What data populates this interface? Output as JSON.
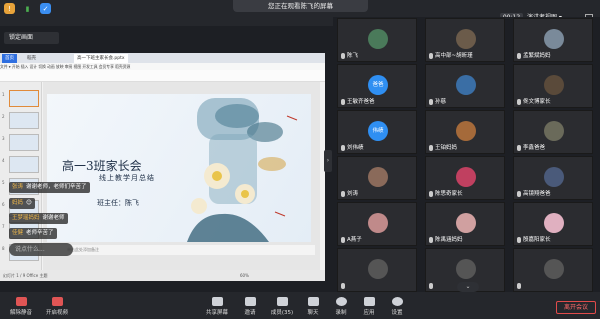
{
  "top": {
    "share_banner": "您正在观看陈飞的屏幕",
    "timer": "00:12",
    "view_mode": "演讲者视图 ▾"
  },
  "screen": {
    "lock_label": "锁定画面",
    "ppt": {
      "tabs": [
        "首页",
        "稻壳",
        "高一下班主家长会.pptx"
      ],
      "menu": "文件 ▾  开始  插入  设计  切换  动画  放映  审阅  视图  开发工具  会员专享  稻壳资源",
      "thumb_numbers": [
        "1",
        "2",
        "3",
        "4",
        "5",
        "6",
        "7",
        "8"
      ],
      "slide_title": "高一3班家长会",
      "slide_subtitle": "线上教学月总结",
      "slide_author": "班主任：陈飞",
      "notes_placeholder": "单击此处添加备注",
      "status": "幻灯片 1 / 9    Office 主题",
      "zoom": "60%"
    },
    "chat": [
      {
        "name": "张涛",
        "text": "谢谢老师，老师们辛苦了"
      },
      {
        "name": "妈妈",
        "text": ""
      },
      {
        "name": "王梦瑶妈妈",
        "text": "谢谢老师"
      },
      {
        "name": "佳健",
        "text": "老师辛苦了"
      }
    ],
    "chat_placeholder": "说点什么..."
  },
  "participants": [
    {
      "name": "陈飞",
      "avatar_text": "",
      "color": "#4a7a5a"
    },
    {
      "name": "高中部~胡昕瑾",
      "avatar_text": "",
      "color": "#6b5b4a"
    },
    {
      "name": "孟繁斌妈妈",
      "avatar_text": "",
      "color": "#7a8a9a"
    },
    {
      "name": "王敏齐爸爸",
      "avatar_text": "爸爸",
      "color": "#2f8ff2"
    },
    {
      "name": "孙慈",
      "avatar_text": "",
      "color": "#3a6ea5"
    },
    {
      "name": "佟文博家长",
      "avatar_text": "",
      "color": "#5a4a3a"
    },
    {
      "name": "刘伟绩",
      "avatar_text": "伟绩",
      "color": "#2f8ff2"
    },
    {
      "name": "王铂妈妈",
      "avatar_text": "",
      "color": "#a56a3a"
    },
    {
      "name": "李鑫爸爸",
      "avatar_text": "",
      "color": "#6a6a5a"
    },
    {
      "name": "刘涛",
      "avatar_text": "",
      "color": "#8a6a5a"
    },
    {
      "name": "陈思奇家长",
      "avatar_text": "",
      "color": "#c04060"
    },
    {
      "name": "高镜翔爸爸",
      "avatar_text": "",
      "color": "#4a5a7a"
    },
    {
      "name": "A燕子",
      "avatar_text": "",
      "color": "#c08a8a"
    },
    {
      "name": "陈禹涵妈妈",
      "avatar_text": "",
      "color": "#d0a0a0"
    },
    {
      "name": "殷嘉阳家长",
      "avatar_text": "",
      "color": "#e0b0c0"
    },
    {
      "name": "",
      "avatar_text": "",
      "color": "#555"
    },
    {
      "name": "",
      "avatar_text": "",
      "color": "#555"
    },
    {
      "name": "",
      "avatar_text": "",
      "color": "#555"
    }
  ],
  "toolbar": {
    "unmute": "解除静音",
    "video": "开启视频",
    "share": "共享屏幕",
    "invite": "邀请",
    "members": "成员(35)",
    "chat": "聊天",
    "record": "录制",
    "apps": "应用",
    "settings": "设置",
    "leave": "离开会议"
  }
}
